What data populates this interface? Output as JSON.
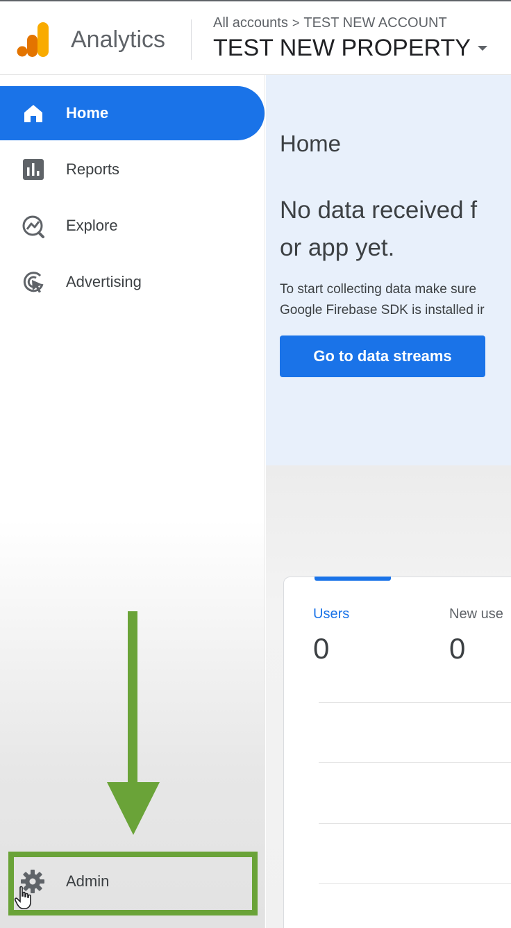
{
  "header": {
    "app_name": "Analytics",
    "breadcrumb": {
      "root": "All accounts",
      "separator": ">",
      "account": "TEST NEW ACCOUNT"
    },
    "property_name": "TEST NEW PROPERTY"
  },
  "sidebar": {
    "items": [
      {
        "label": "Home",
        "icon": "home-icon",
        "active": true
      },
      {
        "label": "Reports",
        "icon": "bar-chart-icon",
        "active": false
      },
      {
        "label": "Explore",
        "icon": "explore-icon",
        "active": false
      },
      {
        "label": "Advertising",
        "icon": "advertising-icon",
        "active": false
      }
    ],
    "admin_label": "Admin"
  },
  "main": {
    "page_title": "Home",
    "headline_line1": "No data received f",
    "headline_line2": "or app yet.",
    "subtext_line1": "To start collecting data make sure",
    "subtext_line2": "Google Firebase SDK is installed ir",
    "cta_label": "Go to data streams",
    "metrics": [
      {
        "label": "Users",
        "value": "0"
      },
      {
        "label": "New use",
        "value": "0"
      }
    ]
  },
  "colors": {
    "accent": "#1a73e8",
    "highlight_green": "#6aa338",
    "logo_orange": "#f9ab00",
    "logo_dark_orange": "#e37400"
  }
}
